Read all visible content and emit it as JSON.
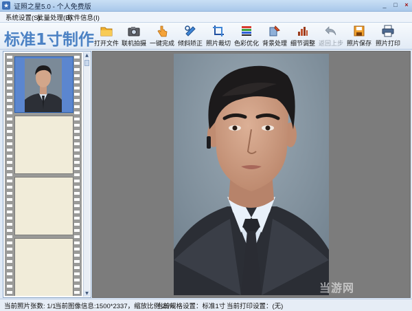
{
  "window": {
    "title": "证照之星5.0 - 个人免费版",
    "controls": {
      "minimize": "_",
      "maximize": "□",
      "close": "×"
    }
  },
  "menu": {
    "items": [
      {
        "label": "系统设置(S)"
      },
      {
        "label": "批量处理(B)"
      },
      {
        "label": "软件信息(I)"
      }
    ]
  },
  "toolbar": {
    "brand": "标准1寸制作",
    "tools": [
      {
        "label": "打开文件",
        "icon": "folder-icon",
        "enabled": true
      },
      {
        "label": "联机拍摄",
        "icon": "camera-icon",
        "enabled": true
      },
      {
        "label": "一键完成",
        "icon": "hand-click-icon",
        "enabled": true
      },
      {
        "label": "倾斜矫正",
        "icon": "rotate-tool-icon",
        "enabled": true
      },
      {
        "label": "照片裁切",
        "icon": "crop-icon",
        "enabled": true
      },
      {
        "label": "色彩优化",
        "icon": "color-bars-icon",
        "enabled": true
      },
      {
        "label": "背景处理",
        "icon": "background-brush-icon",
        "enabled": true
      },
      {
        "label": "细节调整",
        "icon": "detail-adjust-icon",
        "enabled": true
      },
      {
        "label": "返回上步",
        "icon": "undo-icon",
        "enabled": false
      },
      {
        "label": "照片保存",
        "icon": "save-disk-icon",
        "enabled": true
      },
      {
        "label": "照片打印",
        "icon": "printer-icon",
        "enabled": true
      }
    ]
  },
  "film": {
    "frames": [
      {
        "state": "thumbnail"
      },
      {
        "state": "empty"
      },
      {
        "state": "empty"
      },
      {
        "state": "empty"
      }
    ]
  },
  "preview": {
    "watermark": "当游网"
  },
  "status": {
    "photo_count": "当前照片张数: 1/1",
    "image_info": "当前图像信息:1500*2337，缩放比例 25%",
    "spec": "当前规格设置：标准1寸",
    "print": "当前打印设置：(无)"
  },
  "colors": {
    "brand": "#4c82c4",
    "film_strip": "#9a9a98",
    "frame_empty": "#f1ecd9",
    "frame_active_bg": "#5b86cf",
    "preview_bg": "#7c7c7c"
  }
}
